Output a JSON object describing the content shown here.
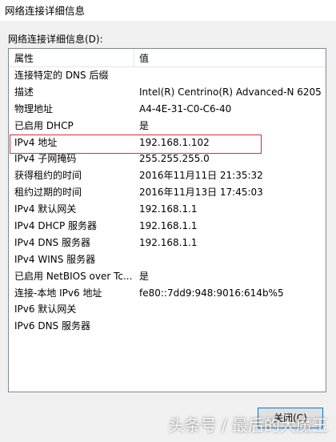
{
  "window": {
    "title": "网络连接详细信息"
  },
  "group_label": "网络连接详细信息(D):",
  "columns": {
    "property": "属性",
    "value": "值"
  },
  "rows": [
    {
      "property": "连接特定的 DNS 后缀",
      "value": ""
    },
    {
      "property": "描述",
      "value": "Intel(R) Centrino(R) Advanced-N 6205"
    },
    {
      "property": "物理地址",
      "value": "A4-4E-31-C0-C6-40"
    },
    {
      "property": "已启用 DHCP",
      "value": "是"
    },
    {
      "property": "IPv4 地址",
      "value": "192.168.1.102"
    },
    {
      "property": "IPv4 子网掩码",
      "value": "255.255.255.0"
    },
    {
      "property": "获得租约的时间",
      "value": "2016年11月11日 21:35:32"
    },
    {
      "property": "租约过期的时间",
      "value": "2016年11月13日 17:45:03"
    },
    {
      "property": "IPv4 默认网关",
      "value": "192.168.1.1"
    },
    {
      "property": "IPv4 DHCP 服务器",
      "value": "192.168.1.1"
    },
    {
      "property": "IPv4 DNS 服务器",
      "value": "192.168.1.1"
    },
    {
      "property": "IPv4 WINS 服务器",
      "value": ""
    },
    {
      "property": "已启用 NetBIOS over Tc...",
      "value": "是"
    },
    {
      "property": "连接-本地 IPv6 地址",
      "value": "fe80::7dd9:948:9016:614b%5"
    },
    {
      "property": "IPv6 默认网关",
      "value": ""
    },
    {
      "property": "IPv6 DNS 服务器",
      "value": ""
    }
  ],
  "close_button": "关闭(C)",
  "watermark": "头条号 / 最后的大魔王",
  "colors": {
    "highlight": "#d92b3a",
    "button_border": "#0078d7"
  }
}
